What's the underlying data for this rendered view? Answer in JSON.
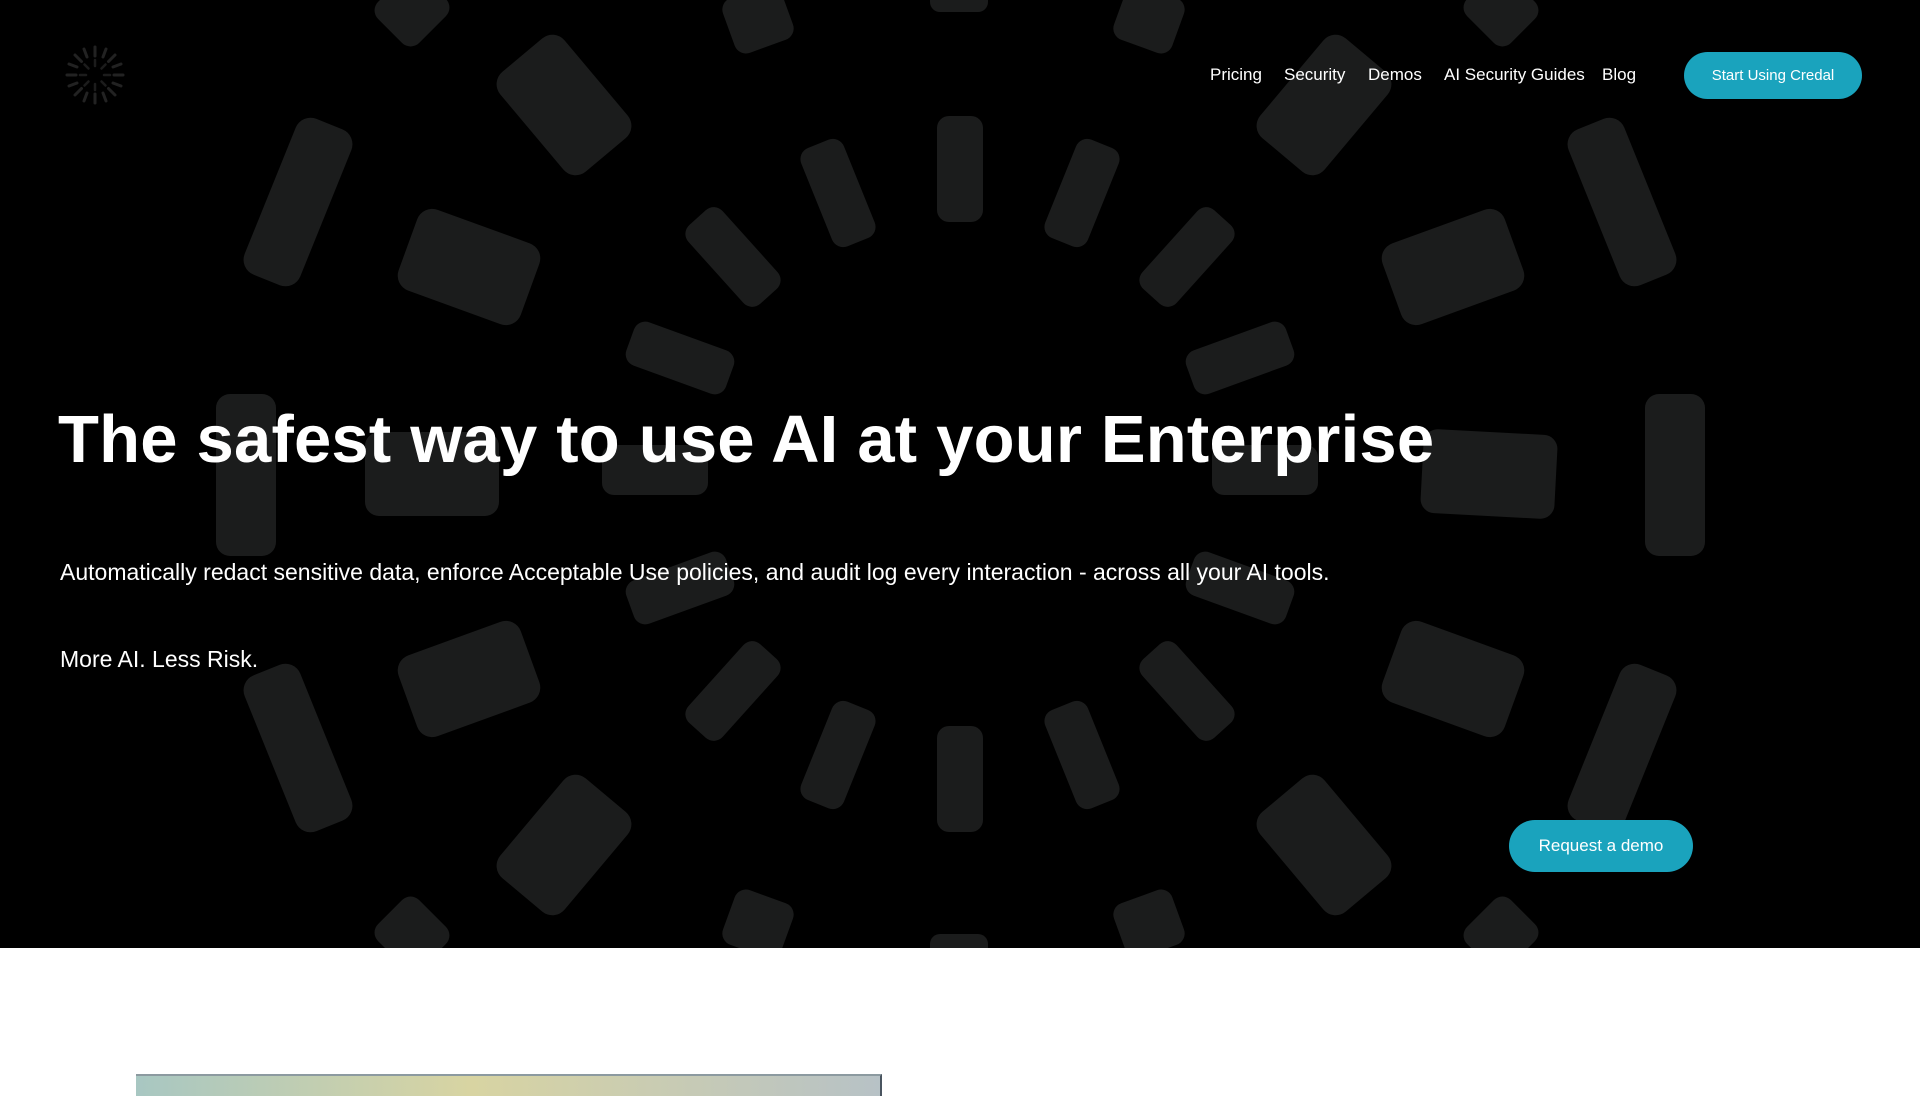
{
  "brand": {
    "logo_icon": "credal-sunburst-logo-icon",
    "accent_color": "#1aa3bd",
    "background_color": "#000000"
  },
  "nav": {
    "items": [
      {
        "label": "Pricing"
      },
      {
        "label": "Security"
      },
      {
        "label": "Demos"
      },
      {
        "label": "AI Security Guides"
      },
      {
        "label": "Blog"
      }
    ],
    "cta_label": "Start Using Credal"
  },
  "hero": {
    "headline": "The safest way to use AI at your Enterprise",
    "subheadline": "Automatically redact sensitive data, enforce Acceptable Use policies, and audit log every interaction - across all your AI tools.",
    "tagline": "More AI. Less Risk.",
    "demo_button_label": "Request a demo"
  }
}
